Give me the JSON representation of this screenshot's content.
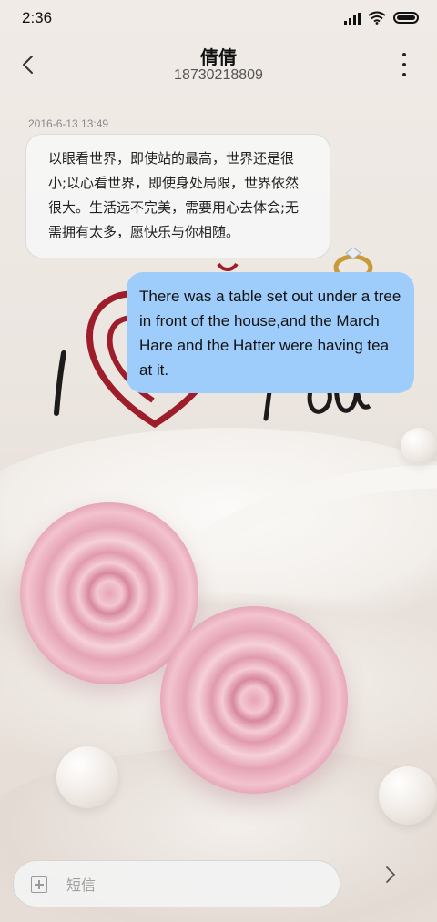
{
  "status_bar": {
    "time": "2:36",
    "icons": [
      "signal-icon",
      "wifi-icon",
      "battery-icon"
    ]
  },
  "header": {
    "contact_name": "倩倩",
    "contact_number": "18730218809",
    "back_icon": "chevron-left-icon",
    "more_icon": "more-vertical-icon"
  },
  "conversation": {
    "timestamp": "2016-6-13 13:49",
    "messages": [
      {
        "direction": "incoming",
        "text": "以眼看世界，即使站的最高，世界还是很小;以心看世界，即使身处局限，世界依然很大。生活远不完美，需要用心去体会;无需拥有太多，愿快乐与你相随。"
      },
      {
        "direction": "outgoing",
        "text": "There was a table set out under a tree in front of the house,and the March Hare and the Hatter were having tea at it."
      }
    ]
  },
  "composer": {
    "attach_icon": "plus-square-icon",
    "placeholder": "短信",
    "value": "",
    "send_icon": "chevron-right-icon"
  },
  "colors": {
    "outgoing_bubble": "#9fcdfb",
    "incoming_bubble": "#f6f6f6",
    "rose_pink": "#e6a4b5"
  }
}
